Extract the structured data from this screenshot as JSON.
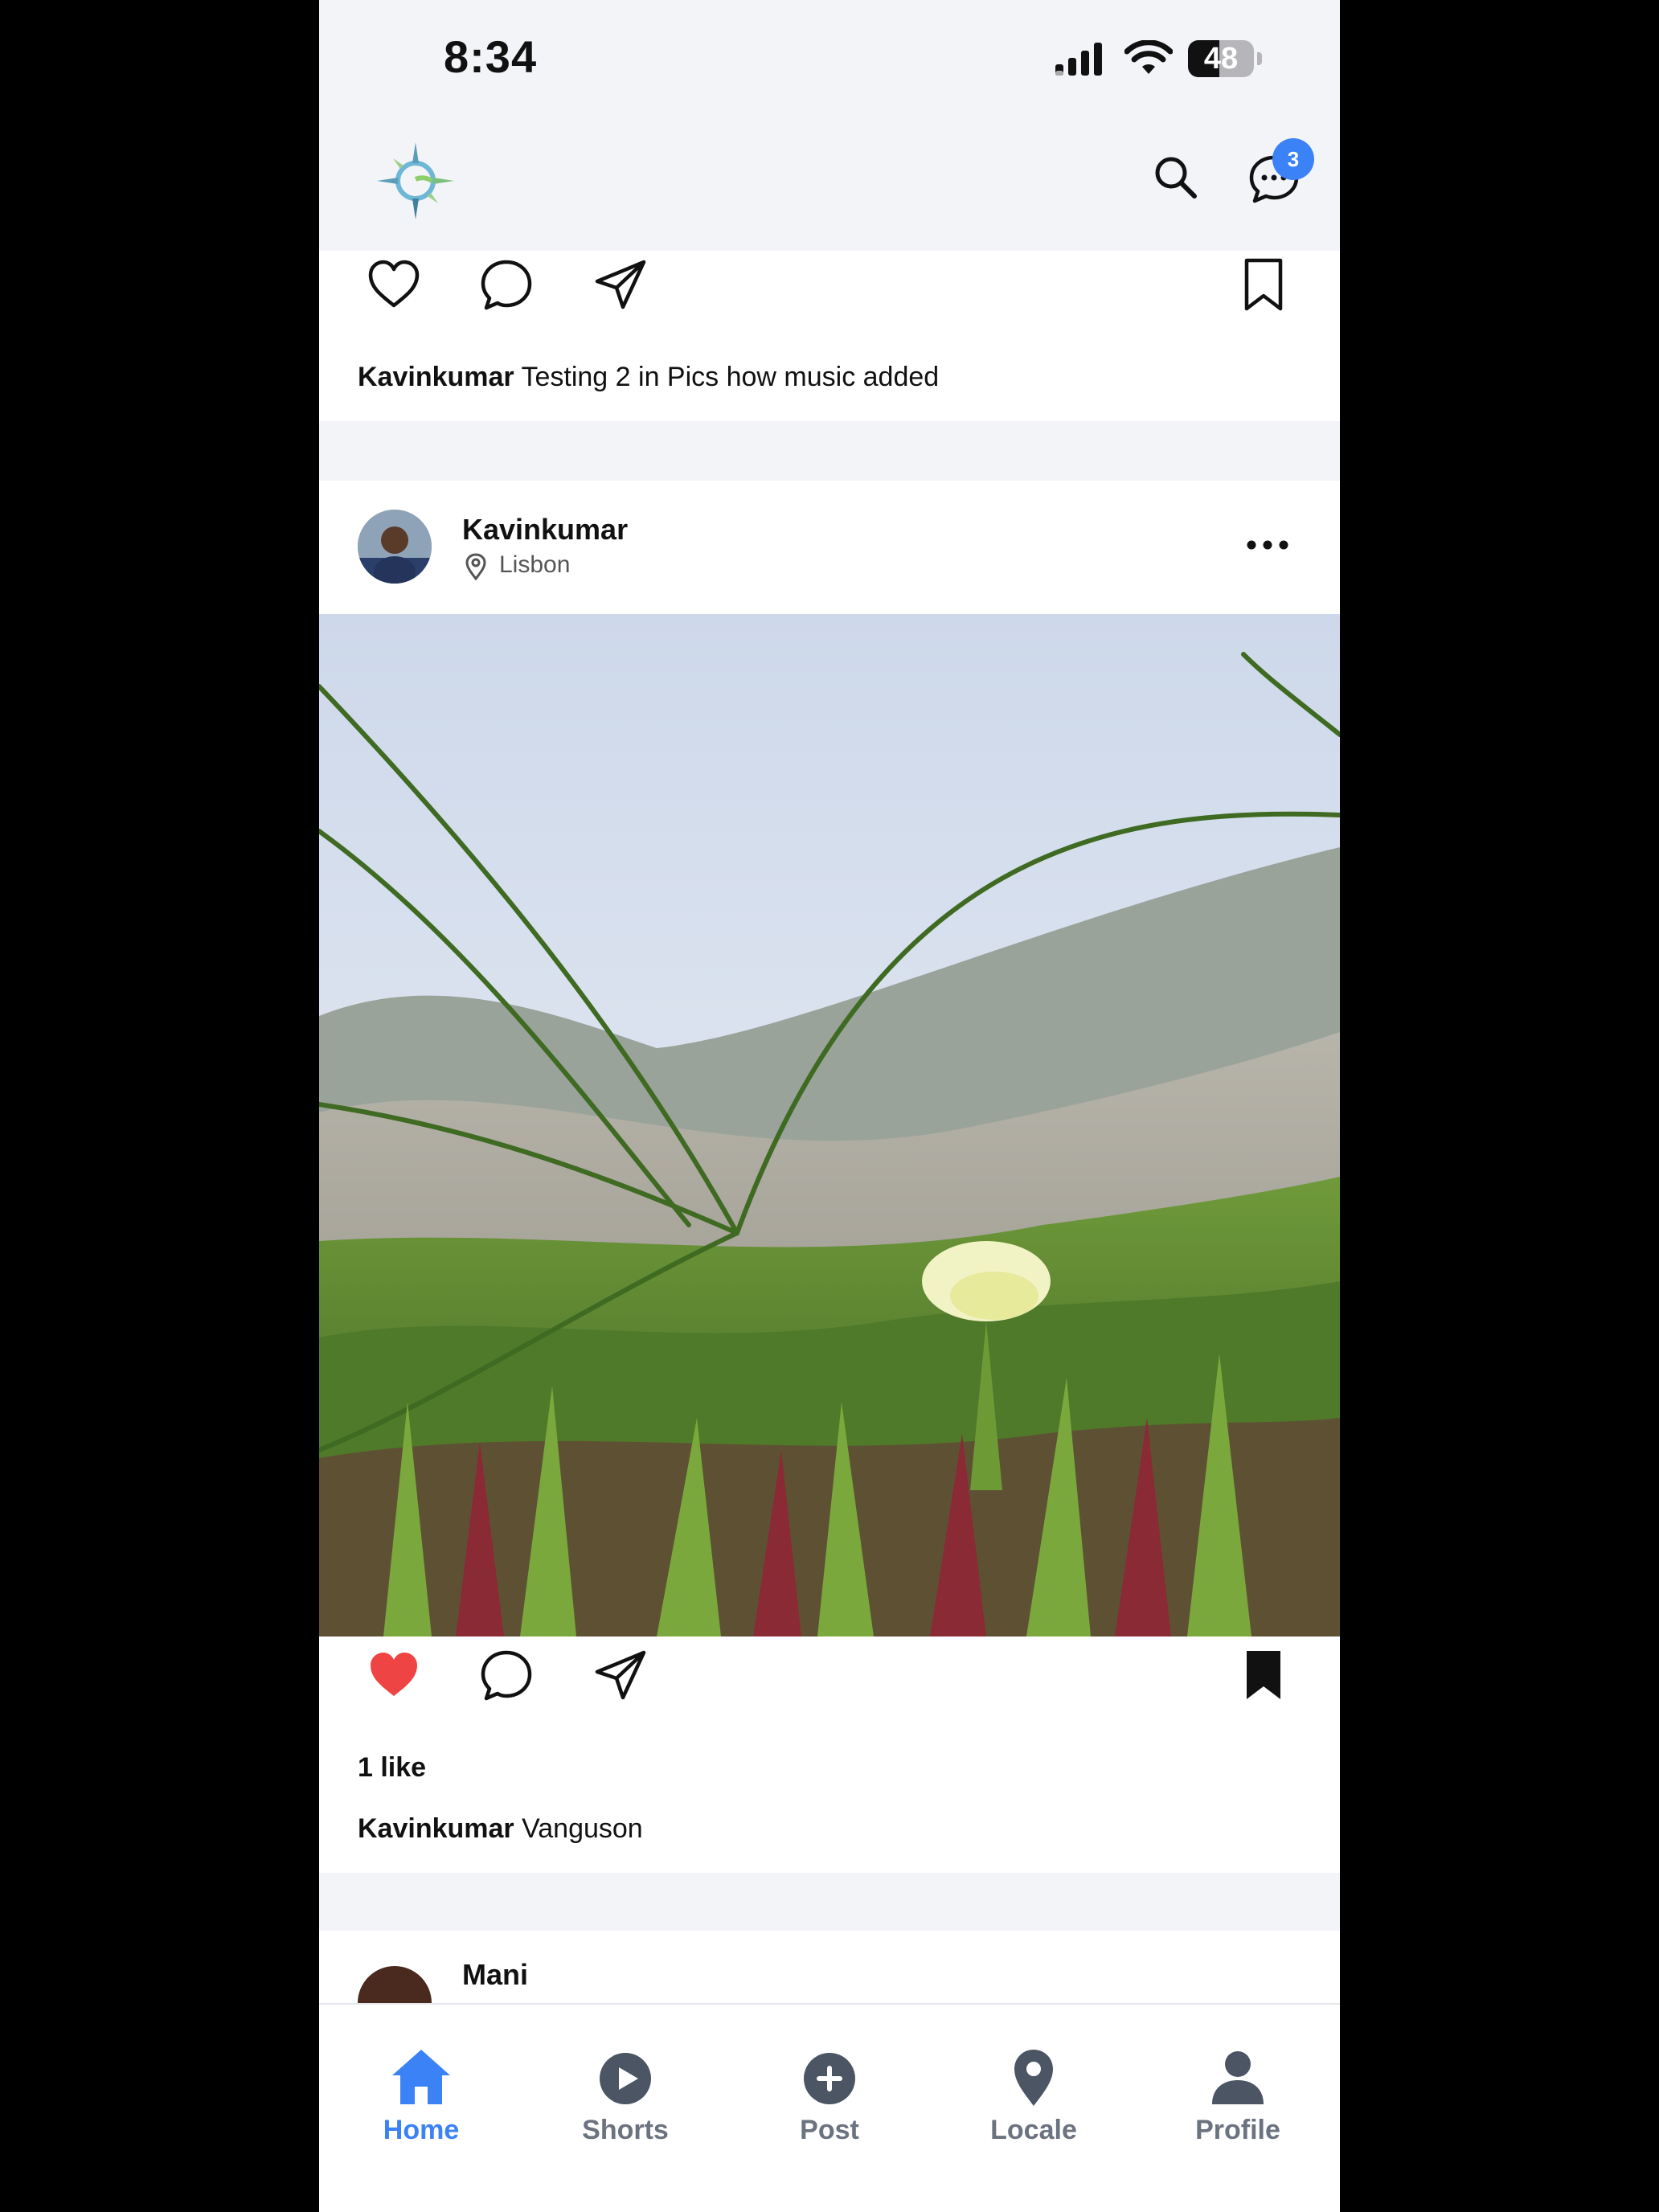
{
  "status_bar": {
    "time": "8:34",
    "battery": "48",
    "battery_level": 0.48
  },
  "header": {
    "logo": "compass-logo",
    "search_icon": "search-icon",
    "chat_icon": "chat-bubble-icon",
    "notification_count": "3"
  },
  "previous_post": {
    "author": "Kavinkumar",
    "caption": "Testing 2 in Pics how music added"
  },
  "post": {
    "author": "Kavinkumar",
    "location": "Lisbon",
    "likes": "1 like",
    "caption_author": "Kavinkumar",
    "caption": "Vanguson",
    "liked": true,
    "saved": true
  },
  "next_post": {
    "author": "Mani"
  },
  "tabs": [
    {
      "label": "Home",
      "icon": "home-icon",
      "active": true
    },
    {
      "label": "Shorts",
      "icon": "play-icon"
    },
    {
      "label": "Post",
      "icon": "plus-icon"
    },
    {
      "label": "Locale",
      "icon": "location-pin-icon"
    },
    {
      "label": "Profile",
      "icon": "person-icon"
    }
  ],
  "colors": {
    "accent": "#3b82f6",
    "like": "#ef4444",
    "background": "#f3f4f8"
  }
}
